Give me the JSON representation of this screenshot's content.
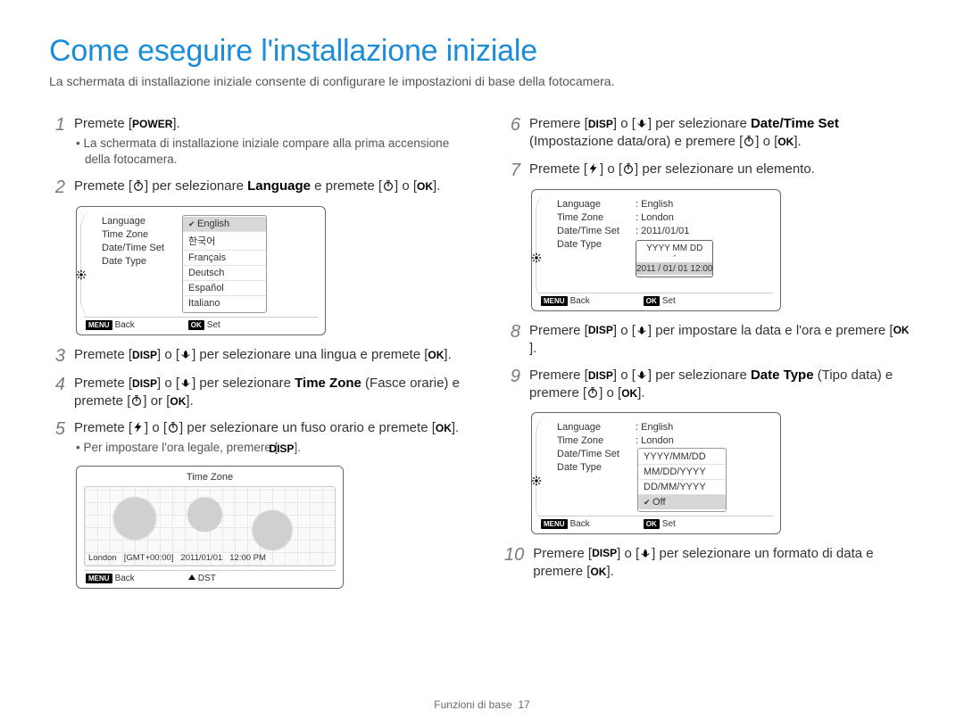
{
  "title": "Come eseguire l'installazione iniziale",
  "subtitle": "La schermata di installazione iniziale consente di configurare le impostazioni di base della fotocamera.",
  "icons": {
    "power": "POWER",
    "disp": "DISP",
    "ok": "OK",
    "menu": "MENU"
  },
  "steps": {
    "1": {
      "text": "Premete [",
      "after": "].",
      "bullet": "La schermata di installazione iniziale compare alla prima accensione della fotocamera."
    },
    "2": {
      "pre": "Premete [",
      "mid": "] per selezionare ",
      "kw": "Language",
      "post": " e premete [",
      "post2": "] o [",
      "end": "]."
    },
    "3": {
      "pre": "Premete [",
      "mid": "] o [",
      "post": "] per selezionare una lingua e premete [",
      "end": "]."
    },
    "4": {
      "pre": "Premete [",
      "mid": "] o [",
      "post": "] per selezionare ",
      "kw": "Time Zone",
      "note": " (Fasce orarie) e premete [",
      "sep": "] or [",
      "end": "]."
    },
    "5": {
      "pre": "Premete [",
      "mid": "] o [",
      "post": "] per selezionare un fuso orario e premete [",
      "end": "].",
      "bullet": "Per impostare l'ora legale, premere ["
    },
    "6": {
      "pre": "Premere [",
      "mid": "] o [",
      "post": "] per selezionare ",
      "kw": "Date/Time Set",
      "note": " (Impostazione data/ora) e premere [",
      "sep": "] o [",
      "end": "]."
    },
    "7": {
      "pre": "Premete [",
      "mid": "] o [",
      "post": "] per selezionare un elemento."
    },
    "8": {
      "pre": "Premere [",
      "mid": "] o [",
      "post": "] per impostare la data e l'ora e premere [",
      "end": "]."
    },
    "9": {
      "pre": "Premere [",
      "mid": "] o [",
      "post": "] per selezionare ",
      "kw": "Date Type",
      "note": " (Tipo data) e premere [",
      "sep": "] o [",
      "end": "]."
    },
    "10": {
      "pre": "Premere [",
      "mid": "] o [",
      "post": "] per selezionare un formato di data e premere [",
      "end": "]."
    }
  },
  "lcd1": {
    "labels": [
      "Language",
      "Time Zone",
      "Date/Time Set",
      "Date Type"
    ],
    "options": [
      "English",
      "한국어",
      "Français",
      "Deutsch",
      "Español",
      "Italiano"
    ],
    "foot_back": "Back",
    "foot_set": "Set"
  },
  "lcd2": {
    "title": "Time Zone",
    "city": "London",
    "gmt": "[GMT+00:00]",
    "date": "2011/01/01",
    "time": "12:00 PM",
    "foot_back": "Back",
    "foot_dst": "DST"
  },
  "lcd3": {
    "labels": [
      "Language",
      "Time Zone",
      "Date/Time Set",
      "Date Type"
    ],
    "values": [
      "English",
      "London",
      "2011/01/01"
    ],
    "date_head": "YYYY MM DD",
    "date_val": "2011 / 01/ 01  12:00",
    "foot_back": "Back",
    "foot_set": "Set"
  },
  "lcd4": {
    "labels": [
      "Language",
      "Time Zone",
      "Date/Time Set",
      "Date Type"
    ],
    "values": [
      "English",
      "London"
    ],
    "options": [
      "YYYY/MM/DD",
      "MM/DD/YYYY",
      "DD/MM/YYYY",
      "Off"
    ],
    "foot_back": "Back",
    "foot_set": "Set"
  },
  "footer": {
    "section": "Funzioni di base",
    "page": "17"
  }
}
